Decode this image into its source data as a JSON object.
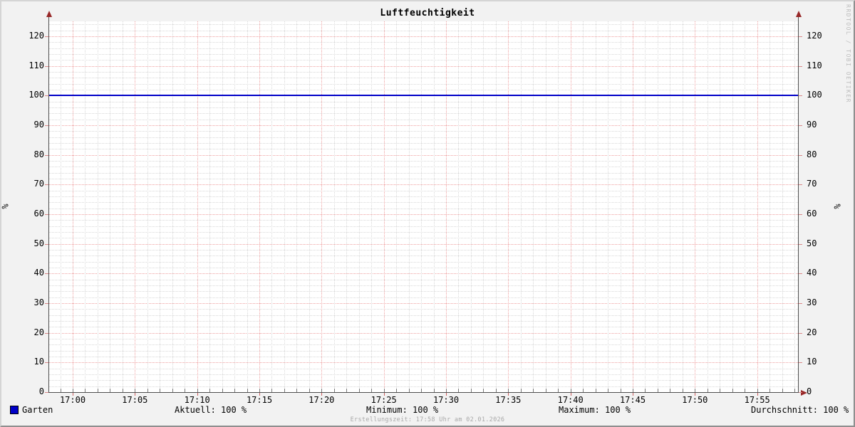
{
  "title": "Luftfeuchtigkeit",
  "vertical_label": "%",
  "watermark": "RRDTOOL / TOBI OETIKER",
  "footer": "Erstellungszeit: 17:58 Uhr am 02.01.2026",
  "legend": {
    "series_label": "Garten",
    "series_color": "#0000c8",
    "stats": [
      {
        "label": "Aktuell",
        "value": "100 %",
        "text": "Aktuell: 100 %"
      },
      {
        "label": "Minimum",
        "value": "100 %",
        "text": "Minimum: 100 %"
      },
      {
        "label": "Maximum",
        "value": "100 %",
        "text": "Maximum: 100 %"
      },
      {
        "label": "Durchschnitt",
        "value": "100 %",
        "text": "Durchschnitt: 100 %"
      }
    ]
  },
  "chart_data": {
    "type": "line",
    "title": "Luftfeuchtigkeit",
    "xlabel": "",
    "ylabel": "%",
    "ylim": [
      0,
      125
    ],
    "y_ticks": [
      0,
      10,
      20,
      30,
      40,
      50,
      60,
      70,
      80,
      90,
      100,
      110,
      120
    ],
    "y_minor_step": 2,
    "x_ticks": [
      "17:00",
      "17:05",
      "17:10",
      "17:15",
      "17:20",
      "17:25",
      "17:30",
      "17:35",
      "17:40",
      "17:45",
      "17:50",
      "17:55"
    ],
    "x_major_step_minutes": 5,
    "x_minor_step_minutes": 1,
    "x_range_minutes_rel_1700": [
      -2,
      58
    ],
    "grid": {
      "major_color": "#efa0a0",
      "minor_color": "#d8d8d8",
      "style": "dotted"
    },
    "legend_position": "bottom",
    "series": [
      {
        "name": "Garten",
        "color": "#0000c8",
        "type": "line",
        "constant_value": 100
      }
    ]
  }
}
